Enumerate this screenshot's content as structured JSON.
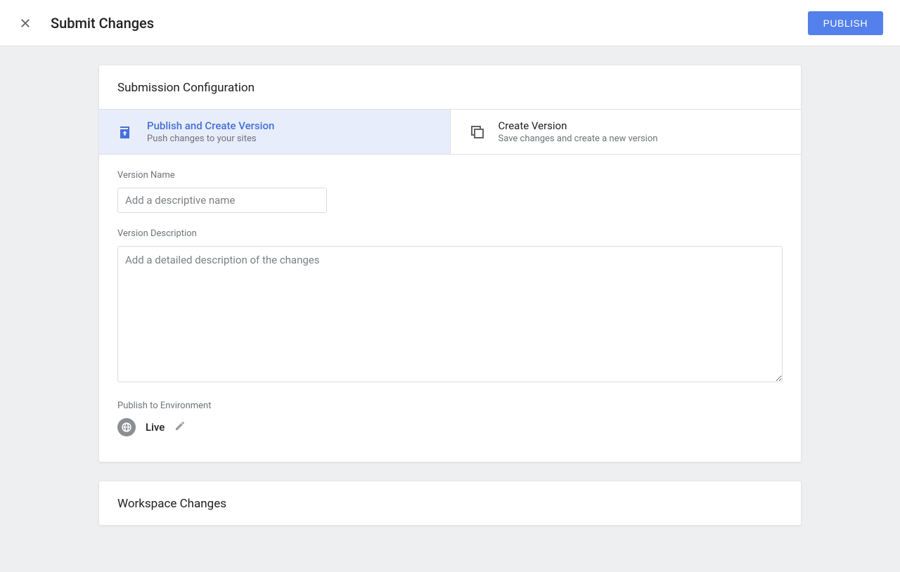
{
  "header": {
    "title": "Submit Changes",
    "publish_button": "PUBLISH"
  },
  "config": {
    "section_title": "Submission Configuration",
    "options": {
      "publish": {
        "title": "Publish and Create Version",
        "subtitle": "Push changes to your sites"
      },
      "create": {
        "title": "Create Version",
        "subtitle": "Save changes and create a new version"
      }
    },
    "version_name": {
      "label": "Version Name",
      "placeholder": "Add a descriptive name",
      "value": ""
    },
    "version_description": {
      "label": "Version Description",
      "placeholder": "Add a detailed description of the changes",
      "value": ""
    },
    "environment": {
      "label": "Publish to Environment",
      "value": "Live"
    }
  },
  "workspace": {
    "section_title": "Workspace Changes"
  }
}
